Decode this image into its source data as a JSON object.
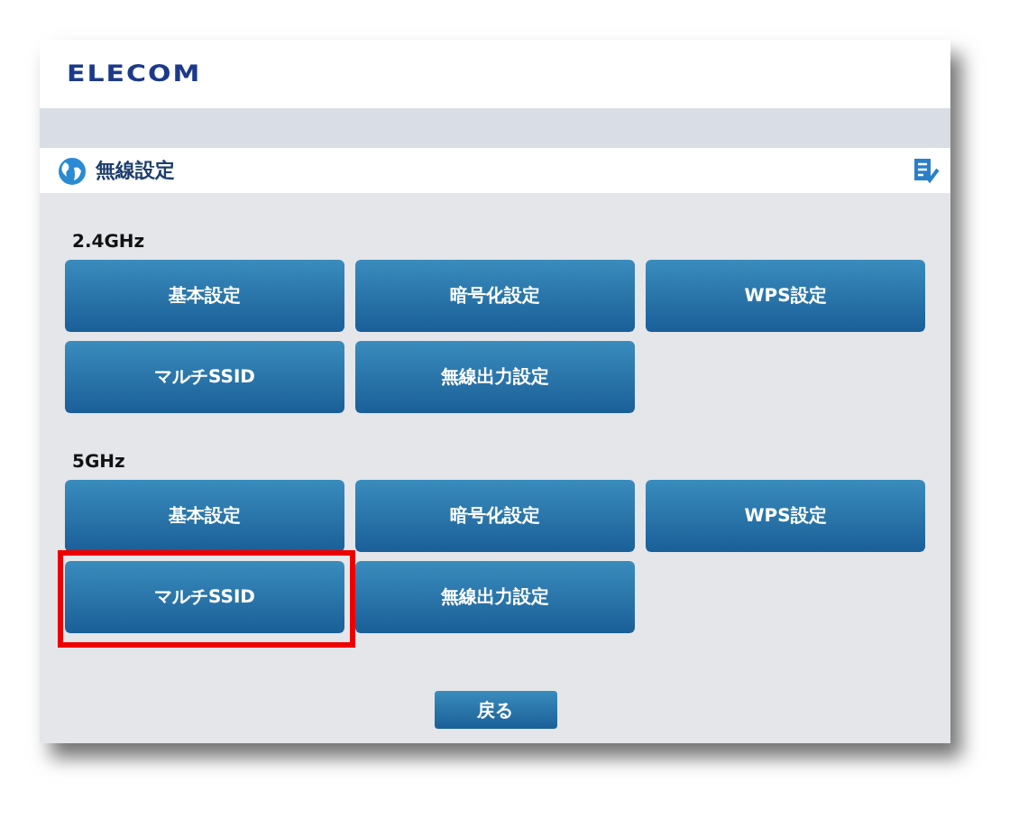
{
  "header": {
    "logo": "ELECOM"
  },
  "title_bar": {
    "title": "無線設定"
  },
  "sections": [
    {
      "label": "2.4GHz",
      "buttons": [
        {
          "label": "基本設定",
          "highlighted": false
        },
        {
          "label": "暗号化設定",
          "highlighted": false
        },
        {
          "label": "WPS設定",
          "highlighted": false
        },
        {
          "label": "マルチSSID",
          "highlighted": false
        },
        {
          "label": "無線出力設定",
          "highlighted": false
        }
      ]
    },
    {
      "label": "5GHz",
      "buttons": [
        {
          "label": "基本設定",
          "highlighted": false
        },
        {
          "label": "暗号化設定",
          "highlighted": false
        },
        {
          "label": "WPS設定",
          "highlighted": false
        },
        {
          "label": "マルチSSID",
          "highlighted": true
        },
        {
          "label": "無線出力設定",
          "highlighted": false
        }
      ]
    }
  ],
  "back_button": {
    "label": "戻る"
  }
}
